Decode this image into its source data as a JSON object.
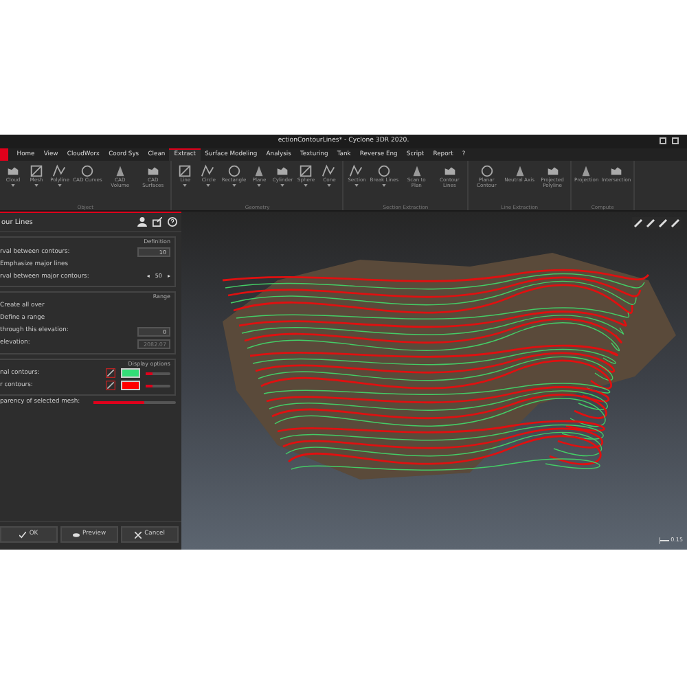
{
  "window": {
    "title": "ectionContourLines* - Cyclone 3DR 2020."
  },
  "menu": [
    {
      "label": "Home",
      "selected": false
    },
    {
      "label": "View",
      "selected": false
    },
    {
      "label": "CloudWorx",
      "selected": false
    },
    {
      "label": "Coord Sys",
      "selected": false
    },
    {
      "label": "Clean",
      "selected": false
    },
    {
      "label": "Extract",
      "selected": true
    },
    {
      "label": "Surface Modeling",
      "selected": false
    },
    {
      "label": "Analysis",
      "selected": false
    },
    {
      "label": "Texturing",
      "selected": false
    },
    {
      "label": "Tank",
      "selected": false
    },
    {
      "label": "Reverse Eng",
      "selected": false
    },
    {
      "label": "Script",
      "selected": false
    },
    {
      "label": "Report",
      "selected": false
    },
    {
      "label": "?",
      "selected": false
    }
  ],
  "ribbon": [
    {
      "label": "Object",
      "tools": [
        {
          "label": "Cloud",
          "caret": true
        },
        {
          "label": "Mesh",
          "caret": true
        },
        {
          "label": "Polyline",
          "caret": true
        },
        {
          "label": "CAD Curves",
          "caret": false
        },
        {
          "label": "CAD Volume",
          "caret": false
        },
        {
          "label": "CAD Surfaces",
          "caret": false
        }
      ]
    },
    {
      "label": "Geometry",
      "tools": [
        {
          "label": "Line",
          "caret": true
        },
        {
          "label": "Circle",
          "caret": true
        },
        {
          "label": "Rectangle",
          "caret": true
        },
        {
          "label": "Plane",
          "caret": true
        },
        {
          "label": "Cylinder",
          "caret": true
        },
        {
          "label": "Sphere",
          "caret": true
        },
        {
          "label": "Cone",
          "caret": true
        }
      ]
    },
    {
      "label": "Section Extraction",
      "tools": [
        {
          "label": "Section",
          "caret": true
        },
        {
          "label": "Break Lines",
          "caret": true
        },
        {
          "label": "Scan to Plan",
          "caret": false
        },
        {
          "label": "Contour Lines",
          "caret": false
        }
      ]
    },
    {
      "label": "Line Extraction",
      "tools": [
        {
          "label": "Planar Contour",
          "caret": false
        },
        {
          "label": "Neutral Axis",
          "caret": false
        },
        {
          "label": "Projected Polyline",
          "caret": false
        }
      ]
    },
    {
      "label": "Compute",
      "tools": [
        {
          "label": "Projection",
          "caret": false
        },
        {
          "label": "Intersection",
          "caret": false
        }
      ]
    }
  ],
  "panel": {
    "title": "our Lines",
    "sections": [
      {
        "title": "Definition",
        "rows": [
          {
            "kind": "field",
            "label": "rval between contours:",
            "value": "10",
            "disabled": false
          },
          {
            "kind": "text",
            "label": "Emphasize major lines"
          },
          {
            "kind": "spinner",
            "label": "rval between major contours:",
            "left": "◂",
            "value": "50",
            "right": "▸"
          }
        ]
      },
      {
        "title": "Range",
        "rows": [
          {
            "kind": "text",
            "label": "Create all over"
          },
          {
            "kind": "text",
            "label": "Define a range"
          },
          {
            "kind": "field",
            "label": "through this elevation:",
            "value": "0",
            "disabled": false
          },
          {
            "kind": "field",
            "label": "elevation:",
            "value": "2082.07",
            "disabled": true
          }
        ]
      },
      {
        "title": "Display options",
        "rows": [
          {
            "kind": "color",
            "label": "nal contours:",
            "color": "#33dd77",
            "level": 0.25
          },
          {
            "kind": "color",
            "label": "r contours:",
            "color": "#ff0000",
            "level": 0.25
          }
        ]
      }
    ],
    "transparency": {
      "label": "parency of selected mesh:",
      "level": 0.62
    },
    "buttons": [
      {
        "label": "OK"
      },
      {
        "label": "Preview"
      },
      {
        "label": "Cancel"
      }
    ]
  },
  "viewport": {
    "scale": "0.15"
  }
}
